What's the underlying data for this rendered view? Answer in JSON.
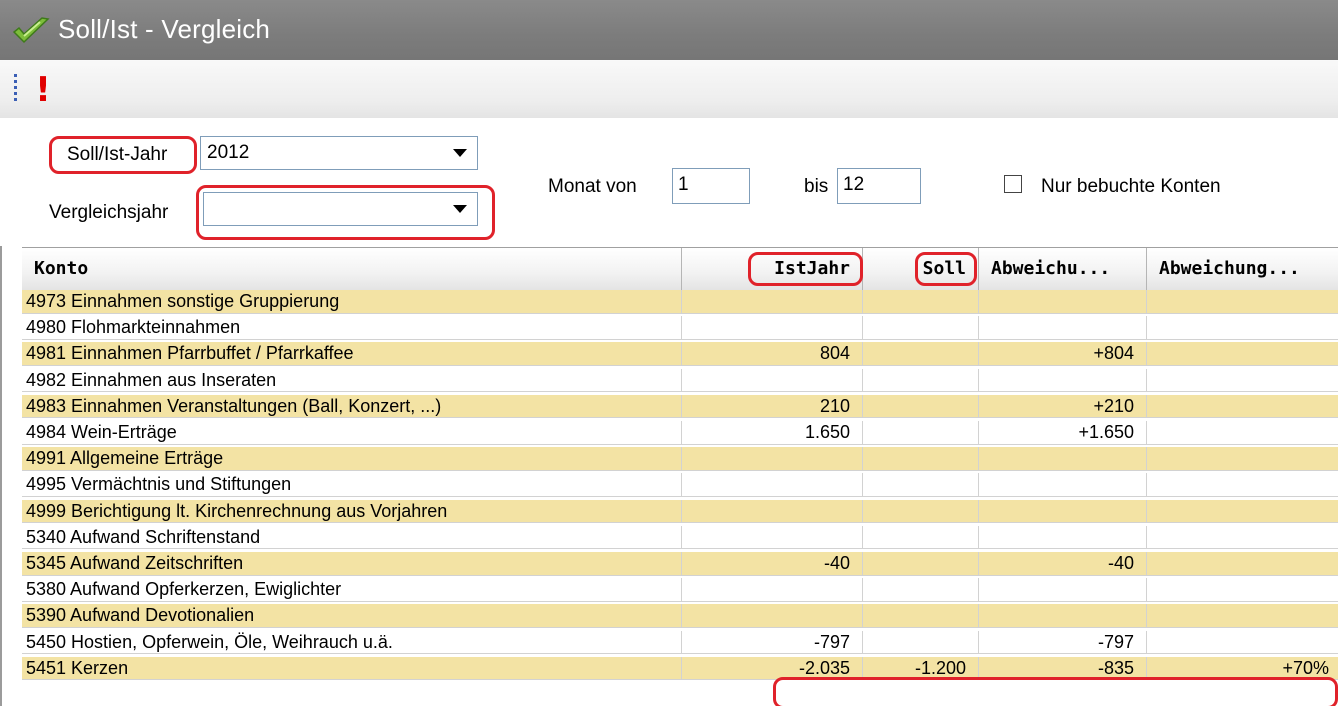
{
  "window": {
    "title": "Soll/Ist - Vergleich"
  },
  "toolbar": {
    "action_glyph": "!"
  },
  "filters": {
    "year_label": "Soll/Ist-Jahr",
    "year_value": "2012",
    "compare_label": "Vergleichsjahr",
    "compare_value": "",
    "month_from_label": "Monat von",
    "month_from_value": "1",
    "month_to_label": "bis",
    "month_to_value": "12",
    "only_booked_label": "Nur bebuchte Konten",
    "only_booked_checked": false
  },
  "table": {
    "columns": [
      "Konto",
      "IstJahr",
      "Soll",
      "Abweichu...",
      "Abweichung..."
    ],
    "rows": [
      [
        "4973 Einnahmen sonstige Gruppierung",
        "",
        "",
        "",
        ""
      ],
      [
        "4980 Flohmarkteinnahmen",
        "",
        "",
        "",
        ""
      ],
      [
        "4981 Einnahmen Pfarrbuffet / Pfarrkaffee",
        "804",
        "",
        "+804",
        ""
      ],
      [
        "4982 Einnahmen aus Inseraten",
        "",
        "",
        "",
        ""
      ],
      [
        "4983 Einnahmen Veranstaltungen (Ball, Konzert, ...)",
        "210",
        "",
        "+210",
        ""
      ],
      [
        "4984 Wein-Erträge",
        "1.650",
        "",
        "+1.650",
        ""
      ],
      [
        "4991 Allgemeine Erträge",
        "",
        "",
        "",
        ""
      ],
      [
        "4995 Vermächtnis und Stiftungen",
        "",
        "",
        "",
        ""
      ],
      [
        "4999 Berichtigung lt. Kirchenrechnung aus Vorjahren",
        "",
        "",
        "",
        ""
      ],
      [
        "5340 Aufwand Schriftenstand",
        "",
        "",
        "",
        ""
      ],
      [
        "5345 Aufwand Zeitschriften",
        "-40",
        "",
        "-40",
        ""
      ],
      [
        "5380 Aufwand Opferkerzen, Ewiglichter",
        "",
        "",
        "",
        ""
      ],
      [
        "5390 Aufwand Devotionalien",
        "",
        "",
        "",
        ""
      ],
      [
        "5450 Hostien, Opferwein, Öle, Weihrauch u.ä.",
        "-797",
        "",
        "-797",
        ""
      ],
      [
        "5451 Kerzen",
        "-2.035",
        "-1.200",
        "-835",
        "+70%"
      ]
    ]
  },
  "colors": {
    "highlight_box": "#e0222a",
    "row_alt": "#f3e3a4",
    "titlebar": "#808080"
  }
}
